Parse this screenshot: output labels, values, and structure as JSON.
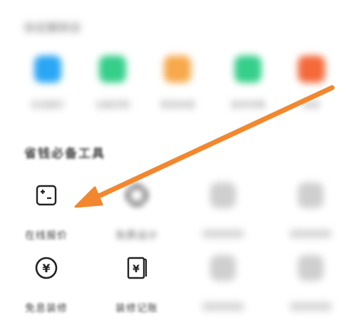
{
  "recent_section": {
    "title": "你近期到访",
    "items": [
      {
        "label": "在线报价",
        "color": "#2aa6f5"
      },
      {
        "label": "全屋定制",
        "color": "#35cf8a"
      },
      {
        "label": "家居商城",
        "color": "#f7a94b"
      },
      {
        "label": "装修攻略",
        "color": "#35cf8a"
      },
      {
        "label": "装修",
        "color": "#f5693a"
      }
    ]
  },
  "tools_section": {
    "title": "省钱必备工具",
    "row1": [
      {
        "label": "在线报价",
        "icon": "calculator-icon"
      },
      {
        "label": "免费设计",
        "icon": "design-icon"
      },
      {
        "label": "",
        "icon": "ghost-icon"
      },
      {
        "label": "",
        "icon": "ghost-icon"
      }
    ],
    "row2": [
      {
        "label": "免息装修",
        "icon": "yen-circle-icon"
      },
      {
        "label": "装修记账",
        "icon": "ledger-icon"
      },
      {
        "label": "",
        "icon": "ghost-icon"
      },
      {
        "label": "",
        "icon": "ghost-icon"
      }
    ]
  },
  "annotation": {
    "arrow_color": "#f2872e",
    "icon_color": "#222222"
  }
}
